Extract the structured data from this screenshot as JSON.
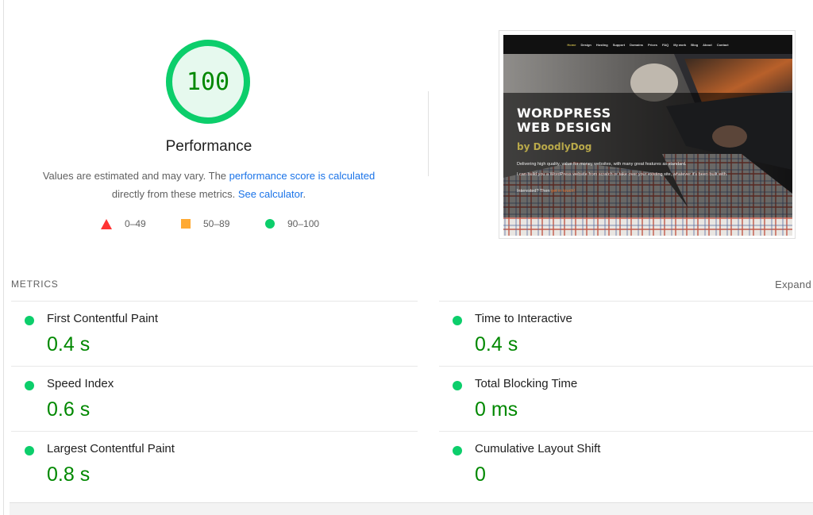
{
  "performance": {
    "score": "100",
    "score_value": 100,
    "title": "Performance",
    "desc_part1": "Values are estimated and may vary. The ",
    "desc_link1": "performance score is calculated",
    "desc_part2": "directly from these metrics. ",
    "desc_link2": "See calculator",
    "desc_part3": "."
  },
  "legend": [
    {
      "range": "0–49",
      "shape": "triangle",
      "color": "#ff3333"
    },
    {
      "range": "50–89",
      "shape": "square",
      "color": "#ffaa33"
    },
    {
      "range": "90–100",
      "shape": "circle",
      "color": "#0cce6b"
    }
  ],
  "thumbnail": {
    "nav": [
      "Home",
      "Design",
      "Hosting",
      "Support",
      "Domains",
      "Prices",
      "FAQ",
      "My work",
      "Blog",
      "About",
      "Contact"
    ],
    "heading_line1": "WORDPRESS",
    "heading_line2": "WEB DESIGN",
    "byline": "by DoodlyDog",
    "para1": "Delivering high quality, value for money websites, with many great features as standard.",
    "para2": "I can build you a WordPress website from scratch or take over your existing site, whatever it's been built with.",
    "para3_prefix": "Interested? Then ",
    "para3_link": "get in touch!"
  },
  "metrics": {
    "header": "METRICS",
    "expand": "Expand",
    "items": [
      {
        "label": "First Contentful Paint",
        "value": "0.4 s"
      },
      {
        "label": "Time to Interactive",
        "value": "0.4 s"
      },
      {
        "label": "Speed Index",
        "value": "0.6 s"
      },
      {
        "label": "Total Blocking Time",
        "value": "0 ms"
      },
      {
        "label": "Largest Contentful Paint",
        "value": "0.8 s"
      },
      {
        "label": "Cumulative Layout Shift",
        "value": "0"
      }
    ]
  },
  "colors": {
    "pass": "#0cce6b",
    "pass_text": "#008800",
    "average": "#ffaa33",
    "fail": "#ff3333",
    "link": "#1a73e8"
  }
}
